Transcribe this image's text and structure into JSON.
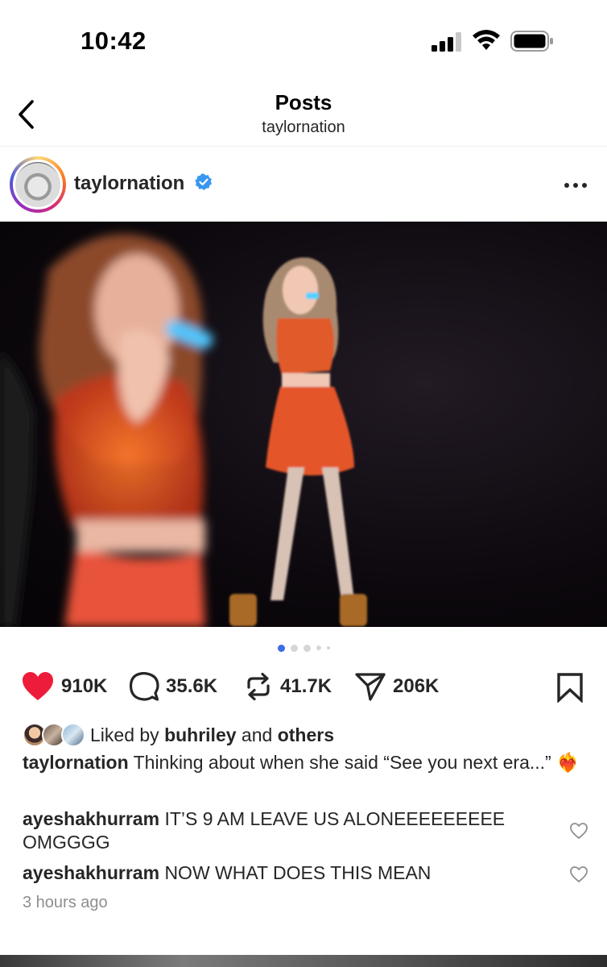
{
  "status_bar": {
    "time": "10:42",
    "icons": [
      "cellular-signal-icon",
      "wifi-icon",
      "battery-icon"
    ]
  },
  "header": {
    "title": "Posts",
    "subtitle": "taylornation",
    "back_icon": "chevron-left-icon"
  },
  "post": {
    "username": "taylornation",
    "verified": true,
    "verified_color": "#3897f0",
    "more_icon": "ellipsis-icon",
    "image_description_icon": "photo",
    "carousel": {
      "total_dots": 5,
      "active_index": 0
    },
    "actions": {
      "likes": "910K",
      "comments": "35.6K",
      "reposts": "41.7K",
      "shares": "206K",
      "like_color": "#ed1c3a"
    },
    "liked_by": {
      "prefix": "Liked by",
      "user": "buhriley",
      "joiner": "and",
      "others": "others"
    },
    "caption": {
      "author": "taylornation",
      "text": "Thinking about when she said “See you next era...” ❤️‍🔥"
    },
    "comments": [
      {
        "author": "ayeshakhurram",
        "text": "IT’S 9 AM LEAVE US ALONEEEEEEEEE OMGGGG"
      },
      {
        "author": "ayeshakhurram",
        "text": "NOW WHAT DOES THIS MEAN"
      }
    ],
    "timestamp": "3 hours ago"
  }
}
